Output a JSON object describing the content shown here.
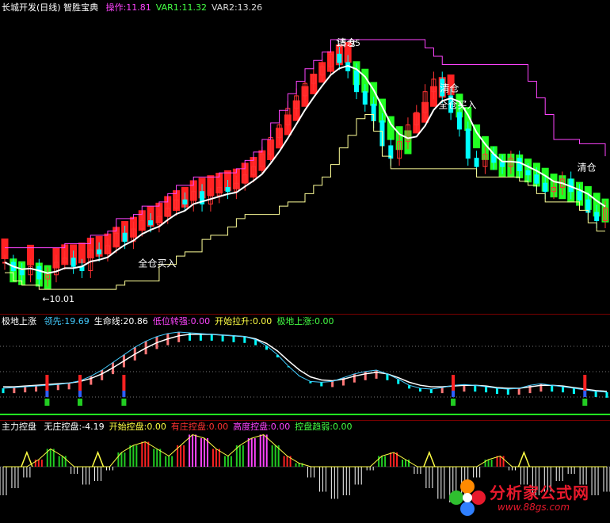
{
  "main_header": {
    "title": "长城开发(日线) 智胜宝典",
    "items": [
      {
        "label": "操作:",
        "value": "11.81",
        "color": "#ff44ff"
      },
      {
        "label": "VAR1:",
        "value": "11.32",
        "color": "#44ff44"
      },
      {
        "label": "VAR2:",
        "value": "13.26",
        "color": "#dddddd"
      }
    ]
  },
  "main_annotations": {
    "high": "15.95",
    "low": "←10.01",
    "buy_label": "全仓买入",
    "sell_label": "清仓"
  },
  "mid_header": {
    "title": "极地上涨",
    "items": [
      {
        "label": "领先:",
        "value": "19.69",
        "color": "#44ccff"
      },
      {
        "label": "生命线:",
        "value": "20.86",
        "color": "#ffffff"
      },
      {
        "label": "低位转强:",
        "value": "0.00",
        "color": "#ff44ff"
      },
      {
        "label": "开始拉升:",
        "value": "0.00",
        "color": "#ffff44"
      },
      {
        "label": "极地上涨:",
        "value": "0.00",
        "color": "#44ff44"
      }
    ]
  },
  "bottom_header": {
    "title": "主力控盘",
    "items": [
      {
        "label": "无庄控盘:",
        "value": "-4.19",
        "color": "#ffffff"
      },
      {
        "label": "开始控盘:",
        "value": "0.00",
        "color": "#ffff44"
      },
      {
        "label": "有庄控盘:",
        "value": "0.00",
        "color": "#ff3333"
      },
      {
        "label": "高度控盘:",
        "value": "0.00",
        "color": "#ff44ff"
      },
      {
        "label": "控盘趋弱:",
        "value": "0.00",
        "color": "#44ff44"
      }
    ]
  },
  "watermark": {
    "title": "分析家公式网",
    "url": "www.88gs.com"
  },
  "colors": {
    "up": "#ff3333",
    "down": "#00ffff",
    "band_up": "#ff2222",
    "band_down": "#22ff22",
    "line_main": "#ffffff",
    "stop_line": "#ff44ff",
    "support_line": "#ffff99",
    "separator": "#7a0000"
  },
  "chart_data": {
    "type": "line",
    "price_range": [
      10.01,
      15.95
    ],
    "close": [
      10.6,
      10.4,
      10.3,
      10.5,
      10.2,
      10.3,
      10.6,
      10.7,
      10.5,
      10.4,
      10.9,
      10.8,
      11.0,
      11.3,
      11.1,
      11.4,
      11.6,
      11.5,
      11.7,
      11.9,
      12.1,
      12.0,
      12.3,
      12.0,
      12.2,
      12.4,
      12.3,
      12.5,
      12.7,
      12.9,
      13.2,
      13.6,
      13.9,
      14.3,
      14.6,
      14.9,
      15.1,
      15.3,
      15.6,
      15.4,
      15.2,
      14.7,
      14.4,
      14.0,
      13.4,
      13.1,
      13.5,
      13.9,
      14.2,
      14.7,
      15.0,
      14.6,
      14.2,
      13.8,
      13.1,
      12.9,
      13.2,
      13.0,
      12.9,
      13.1,
      12.8,
      12.7,
      12.5,
      12.3,
      12.4,
      12.6,
      12.3,
      12.1,
      11.8,
      11.6,
      11.9
    ],
    "indicator_lead": [
      0.26,
      0.27,
      0.28,
      0.29,
      0.3,
      0.31,
      0.33,
      0.36,
      0.42,
      0.5,
      0.6,
      0.7,
      0.8,
      0.88,
      0.94,
      0.98,
      1.0,
      0.99,
      0.98,
      0.97,
      0.96,
      0.95,
      0.94,
      0.9,
      0.82,
      0.7,
      0.55,
      0.42,
      0.35,
      0.34,
      0.35,
      0.4,
      0.45,
      0.48,
      0.5,
      0.45,
      0.38,
      0.3,
      0.26,
      0.25,
      0.27,
      0.3,
      0.31,
      0.3,
      0.28,
      0.26,
      0.25,
      0.26,
      0.3,
      0.32,
      0.3,
      0.28,
      0.26,
      0.24,
      0.22,
      0.21
    ],
    "indicator_life": [
      0.28,
      0.28,
      0.29,
      0.3,
      0.31,
      0.32,
      0.33,
      0.35,
      0.39,
      0.45,
      0.53,
      0.62,
      0.71,
      0.79,
      0.86,
      0.91,
      0.95,
      0.97,
      0.97,
      0.97,
      0.96,
      0.95,
      0.94,
      0.91,
      0.85,
      0.75,
      0.62,
      0.5,
      0.41,
      0.37,
      0.36,
      0.38,
      0.42,
      0.45,
      0.47,
      0.45,
      0.4,
      0.34,
      0.3,
      0.28,
      0.28,
      0.29,
      0.3,
      0.3,
      0.29,
      0.27,
      0.26,
      0.26,
      0.28,
      0.3,
      0.3,
      0.29,
      0.27,
      0.25,
      0.23,
      0.22
    ],
    "control": [
      -0.8,
      -0.6,
      -0.3,
      0.2,
      0.5,
      0.3,
      -0.2,
      -0.5,
      -0.4,
      -0.1,
      0.4,
      0.6,
      0.7,
      0.5,
      0.3,
      0.6,
      0.9,
      0.8,
      0.5,
      0.3,
      0.6,
      0.8,
      0.9,
      0.6,
      0.3,
      0.1,
      -0.3,
      -0.7,
      -0.9,
      -0.8,
      -0.5,
      -0.1,
      0.3,
      0.4,
      0.2,
      -0.2,
      -0.6,
      -0.9,
      -1.0,
      -0.8,
      -0.3,
      0.2,
      0.3,
      -0.1,
      -0.5,
      -0.8,
      -0.7,
      -0.4,
      -0.2,
      -0.5,
      -0.8,
      -0.7
    ]
  }
}
